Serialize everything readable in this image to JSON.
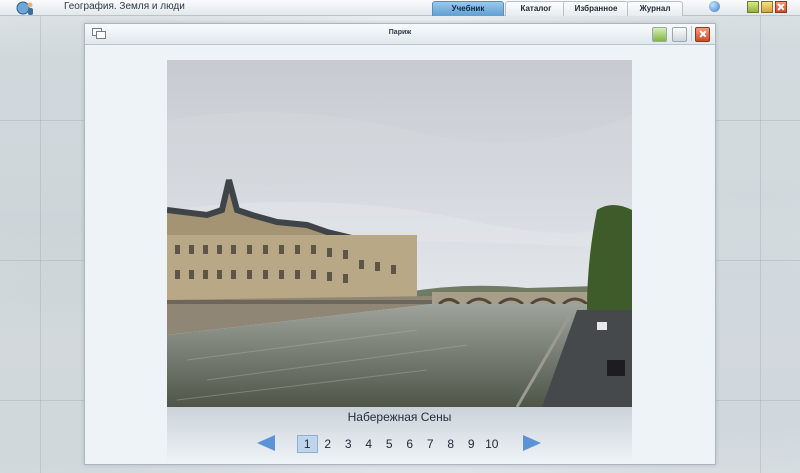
{
  "app": {
    "title": "География. Земля и люди"
  },
  "tabs": [
    {
      "label": "Учебник",
      "active": true
    },
    {
      "label": "Каталог",
      "active": false
    },
    {
      "label": "Избранное",
      "active": false
    },
    {
      "label": "Журнал",
      "active": false
    }
  ],
  "icons": {
    "logo": "globe-person-icon",
    "help": "help-icon",
    "minimize": "minimize-icon",
    "maximize": "maximize-icon",
    "close": "close-icon",
    "save": "save-icon",
    "print": "print-icon"
  },
  "dialog": {
    "title": "Париж",
    "caption": "Набережная Сены"
  },
  "pager": {
    "pages": [
      "1",
      "2",
      "3",
      "4",
      "5",
      "6",
      "7",
      "8",
      "9",
      "10"
    ],
    "current": "1"
  },
  "colors": {
    "accent": "#5b93d6",
    "active_tab": "#6aa5d6",
    "close": "#d04b23"
  }
}
